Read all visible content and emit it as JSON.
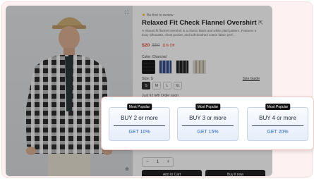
{
  "product": {
    "rating_text": "Be first to review",
    "title": "Relaxed Fit Check Flannel Overshirt",
    "description": "A relaxed fit flannel overshirt in a classic black and white plaid pattern. Features a boxy silhouette, chest pocket, and soft brushed cotton fabric perf...",
    "price_now": "$20",
    "price_was": "$59",
    "price_off": "11% Off",
    "color_label": "Color: Charcoal",
    "size_label": "Size: S",
    "size_guide": "Size Guide",
    "sizes": [
      "S",
      "M",
      "L",
      "XL"
    ],
    "stock": "Just 92 left! Order soon",
    "qty_minus": "−",
    "qty_value": "1",
    "qty_plus": "+",
    "add_to_cart": "Add to Cart",
    "buy_now": "Buy it now",
    "icons": {
      "expand": "expand-icon",
      "zoom": "zoom-icon",
      "share": "share-icon",
      "star": "star-icon"
    }
  },
  "discount_tiers": [
    {
      "badge": "Most Popular",
      "buy": "BUY 2 or more",
      "get": "GET 10%"
    },
    {
      "badge": "Most Popular",
      "buy": "BUY 3 or more",
      "get": "GET 15%"
    },
    {
      "badge": "Most Popular",
      "buy": "BUY 4 or more",
      "get": "GET 20%"
    }
  ],
  "colors": {
    "accent_red": "#e53935",
    "tier_blue": "#2b66c7",
    "popup_border": "#f2c9c4"
  }
}
